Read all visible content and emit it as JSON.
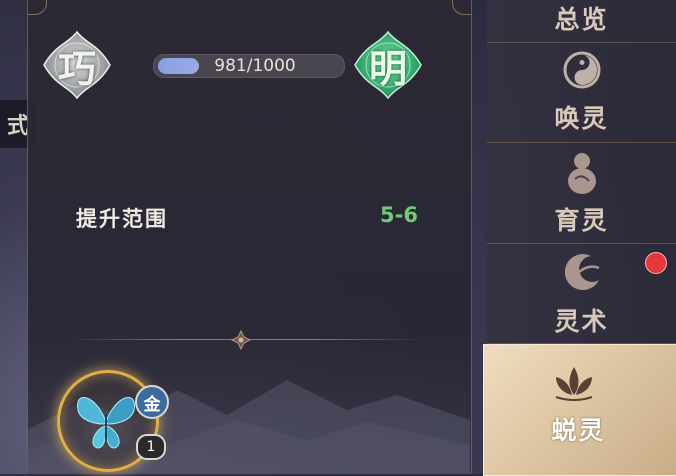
{
  "edge_tab": {
    "label": "式"
  },
  "badges": {
    "left": {
      "char": "巧"
    },
    "right": {
      "char": "明"
    }
  },
  "progress": {
    "current": 981,
    "max": 1000,
    "text": "981/1000"
  },
  "stat": {
    "label": "提升范围",
    "value": "5-6"
  },
  "pet": {
    "grade": "金",
    "level": "1",
    "icon": "butterfly-icon"
  },
  "nav": {
    "items": [
      {
        "label": "总览",
        "icon": "",
        "active": false
      },
      {
        "label": "唤灵",
        "icon": "yin-yang-icon",
        "active": false
      },
      {
        "label": "育灵",
        "icon": "gourd-icon",
        "active": false,
        "notification": true
      },
      {
        "label": "灵术",
        "icon": "moon-swirl-icon",
        "active": false
      },
      {
        "label": "蜕灵",
        "icon": "lotus-icon",
        "active": true
      }
    ]
  },
  "colors": {
    "stat_value": "#6fcc74",
    "progress_fill": "#8a9fe0",
    "ring_gold": "#e0b046",
    "active_nav": "#e5d1b2",
    "notification": "#e5383b"
  }
}
